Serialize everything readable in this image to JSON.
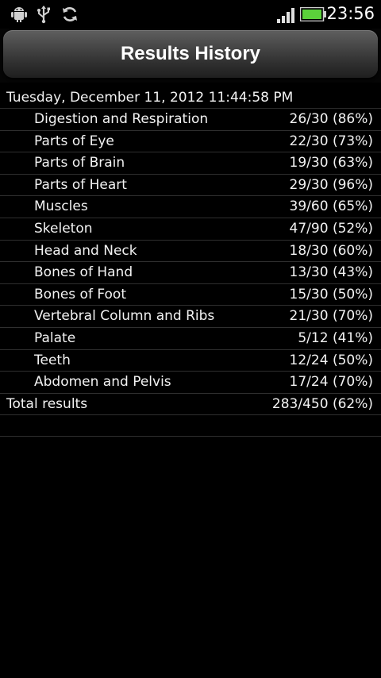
{
  "status_bar": {
    "time": "23:56",
    "icons": [
      "android-debug-icon",
      "usb-icon",
      "sync-icon",
      "signal-icon",
      "battery-icon"
    ]
  },
  "title": "Results History",
  "session": {
    "date": "Tuesday, December 11, 2012 11:44:58 PM",
    "results": [
      {
        "name": "Digestion and Respiration",
        "score": "26/30 (86%)"
      },
      {
        "name": "Parts of Eye",
        "score": "22/30 (73%)"
      },
      {
        "name": "Parts of Brain",
        "score": "19/30 (63%)"
      },
      {
        "name": "Parts of Heart",
        "score": "29/30 (96%)"
      },
      {
        "name": "Muscles",
        "score": "39/60 (65%)"
      },
      {
        "name": "Skeleton",
        "score": "47/90 (52%)"
      },
      {
        "name": "Head and Neck",
        "score": "18/30 (60%)"
      },
      {
        "name": "Bones of Hand",
        "score": "13/30 (43%)"
      },
      {
        "name": "Bones of Foot",
        "score": "15/30 (50%)"
      },
      {
        "name": "Vertebral Column and Ribs",
        "score": "21/30 (70%)"
      },
      {
        "name": "Palate",
        "score": "5/12 (41%)"
      },
      {
        "name": "Teeth",
        "score": "12/24 (50%)"
      },
      {
        "name": "Abdomen and Pelvis",
        "score": "17/24 (70%)"
      }
    ],
    "total": {
      "name": "Total results",
      "score": "283/450 (62%)"
    }
  },
  "colors": {
    "background": "#000000",
    "text": "#f2f2f2",
    "divider": "#2f2f2f",
    "battery": "#5bd13b"
  }
}
